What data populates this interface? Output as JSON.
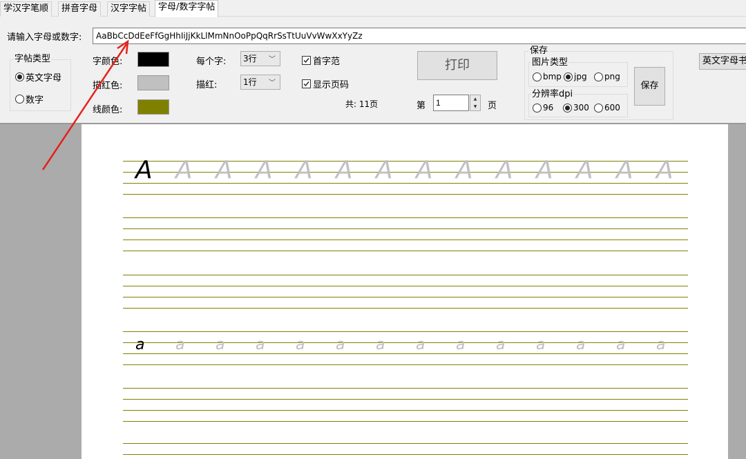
{
  "tabs": [
    {
      "label": "学汉字笔顺"
    },
    {
      "label": "拼音字母"
    },
    {
      "label": "汉字字帖"
    },
    {
      "label": "字母/数字字帖"
    }
  ],
  "input": {
    "label": "请输入字母或数字:",
    "value": "AaBbCcDdEeFfGgHhIiJjKkLlMmNnOoPpQqRrSsTtUuVvWwXxYyZz"
  },
  "copybook_type": {
    "title": "字帖类型",
    "options": [
      {
        "label": "英文字母",
        "selected": true
      },
      {
        "label": "数字",
        "selected": false
      }
    ]
  },
  "colors": {
    "char_color_label": "字颜色:",
    "char_color": "#000000",
    "trace_color_label": "描红色:",
    "trace_color": "#c0c0c0",
    "line_color_label": "线颜色:",
    "line_color": "#808000"
  },
  "per_char": {
    "label": "每个字:",
    "value": "3行"
  },
  "trace": {
    "label": "描红:",
    "value": "1行"
  },
  "options": {
    "first_example": {
      "label": "首字范",
      "checked": true
    },
    "show_page_number": {
      "label": "显示页码",
      "checked": true
    }
  },
  "print_button": "打印",
  "pages": {
    "total_text": "共: 11页",
    "page_prefix": "第",
    "page_value": "1",
    "page_suffix": "页"
  },
  "save": {
    "title": "保存",
    "image_type_title": "图片类型",
    "image_types": [
      {
        "label": "bmp",
        "selected": false
      },
      {
        "label": "jpg",
        "selected": true
      },
      {
        "label": "png",
        "selected": false
      }
    ],
    "dpi_title": "分辨率dpi",
    "dpi_options": [
      {
        "label": "96",
        "selected": false
      },
      {
        "label": "300",
        "selected": true
      },
      {
        "label": "600",
        "selected": false
      }
    ],
    "button": "保存"
  },
  "right_button": "英文字母书",
  "sheet": {
    "rows": [
      {
        "model": "A",
        "trace": "A"
      },
      {
        "model": "a",
        "trace": "a"
      }
    ]
  }
}
